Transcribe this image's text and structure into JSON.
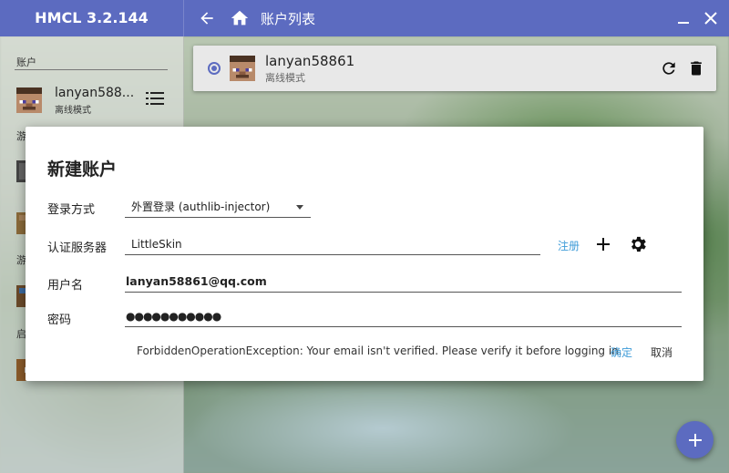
{
  "window": {
    "app_title": "HMCL 3.2.144",
    "page_title": "账户列表"
  },
  "sidebar": {
    "accounts_section": "账户",
    "current_account": {
      "name": "lanyan588...",
      "type": "离线模式"
    },
    "section_2_partial": "游",
    "section_3_partial": "游",
    "section_4_partial": "启"
  },
  "account_list": [
    {
      "name": "lanyan58861",
      "type": "离线模式",
      "selected": true
    }
  ],
  "dialog": {
    "title": "新建账户",
    "login_method_label": "登录方式",
    "login_method_value": "外置登录 (authlib-injector)",
    "auth_server_label": "认证服务器",
    "auth_server_value": "LittleSkin",
    "register_link": "注册",
    "username_label": "用户名",
    "username_value": "lanyan58861@qq.com",
    "password_label": "密码",
    "password_value": "●●●●●●●●●●●",
    "error_message": "ForbiddenOperationException: Your email isn't verified. Please verify it before logging in.",
    "confirm_label": "确定",
    "cancel_label": "取消"
  },
  "colors": {
    "accent": "#5c6bc0",
    "link": "#3f9cd8"
  },
  "icons": [
    "back-arrow-icon",
    "home-icon",
    "minimize-icon",
    "close-icon",
    "menu-icon",
    "refresh-icon",
    "delete-icon",
    "add-icon",
    "settings-icon"
  ]
}
